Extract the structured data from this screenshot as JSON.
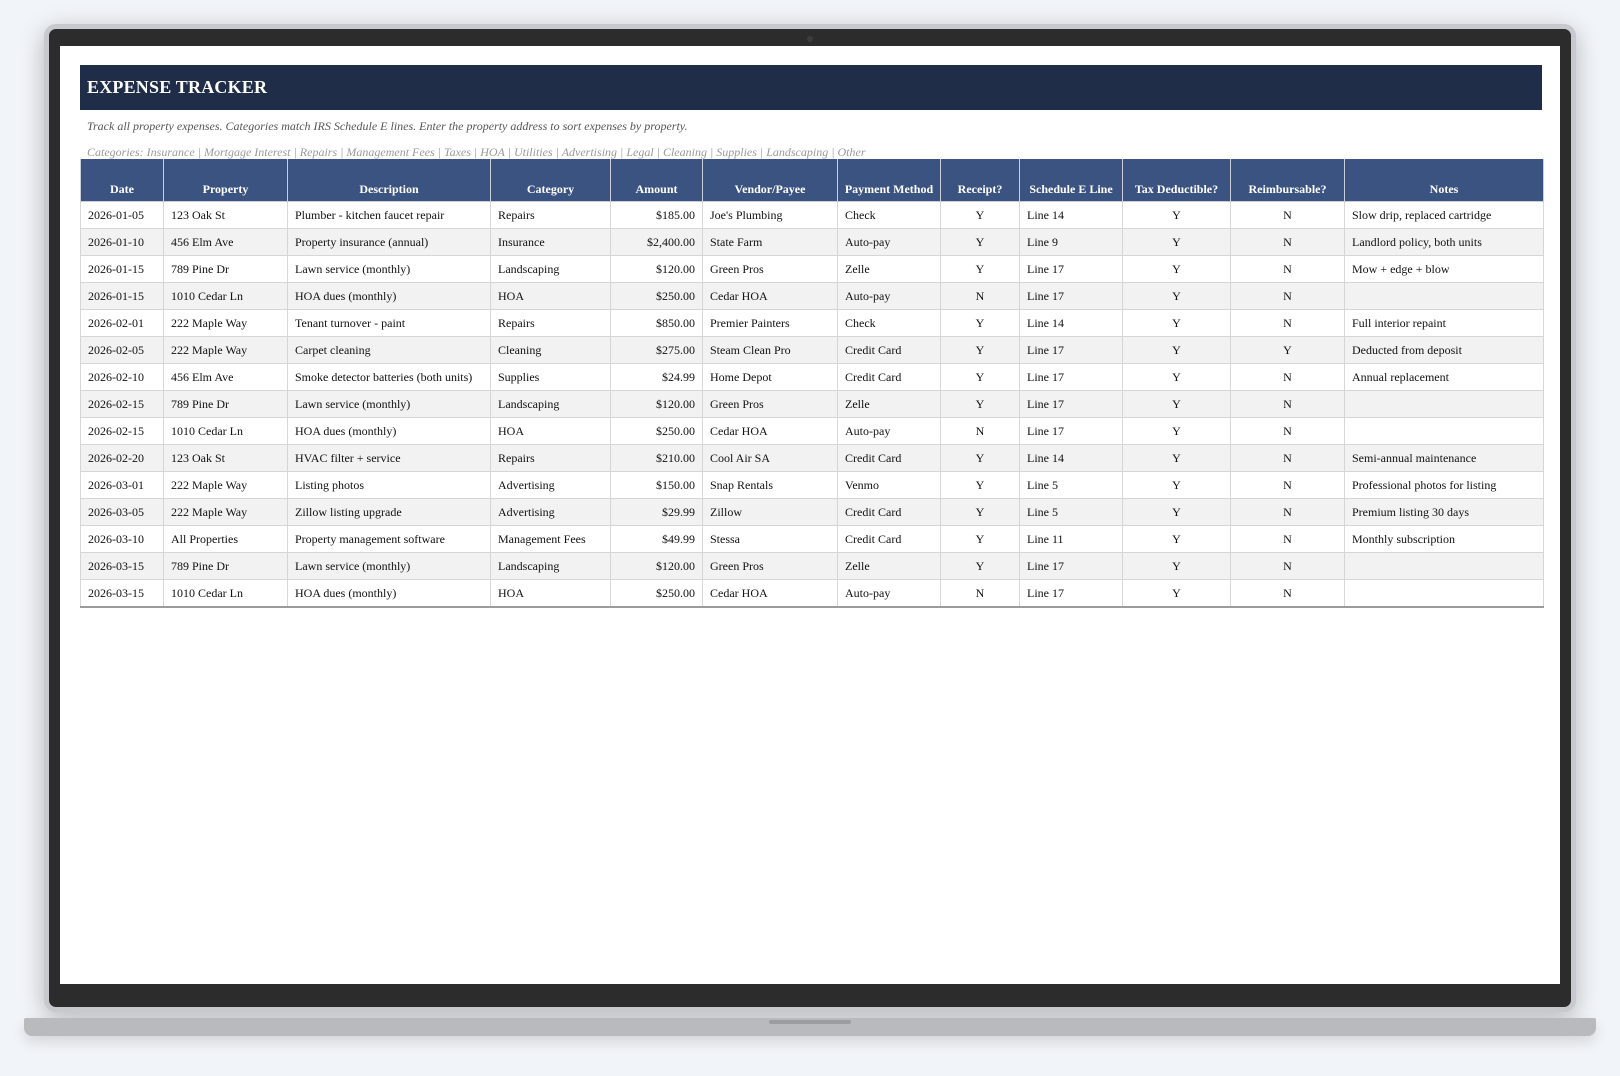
{
  "sheet": {
    "title": "EXPENSE TRACKER",
    "subtitle": "Track all property expenses. Categories match IRS Schedule E lines. Enter the property address to sort expenses by property.",
    "categories_note": "Categories: Insurance | Mortgage Interest | Repairs | Management Fees | Taxes | HOA | Utilities | Advertising | Legal | Cleaning | Supplies | Landscaping | Other"
  },
  "table": {
    "headers": [
      "Date",
      "Property",
      "Description",
      "Category",
      "Amount",
      "Vendor/Payee",
      "Payment Method",
      "Receipt?",
      "Schedule E Line",
      "Tax Deductible?",
      "Reimbursable?",
      "Notes"
    ],
    "rows": [
      [
        "2026-01-05",
        "123 Oak St",
        "Plumber - kitchen faucet repair",
        "Repairs",
        "$185.00",
        "Joe's Plumbing",
        "Check",
        "Y",
        "Line 14",
        "Y",
        "N",
        "Slow drip, replaced cartridge"
      ],
      [
        "2026-01-10",
        "456 Elm Ave",
        "Property insurance (annual)",
        "Insurance",
        "$2,400.00",
        "State Farm",
        "Auto-pay",
        "Y",
        "Line 9",
        "Y",
        "N",
        "Landlord policy, both units"
      ],
      [
        "2026-01-15",
        "789 Pine Dr",
        "Lawn service (monthly)",
        "Landscaping",
        "$120.00",
        "Green Pros",
        "Zelle",
        "Y",
        "Line 17",
        "Y",
        "N",
        "Mow + edge + blow"
      ],
      [
        "2026-01-15",
        "1010 Cedar Ln",
        "HOA dues (monthly)",
        "HOA",
        "$250.00",
        "Cedar HOA",
        "Auto-pay",
        "N",
        "Line 17",
        "Y",
        "N",
        ""
      ],
      [
        "2026-02-01",
        "222 Maple Way",
        "Tenant turnover - paint",
        "Repairs",
        "$850.00",
        "Premier Painters",
        "Check",
        "Y",
        "Line 14",
        "Y",
        "N",
        "Full interior repaint"
      ],
      [
        "2026-02-05",
        "222 Maple Way",
        "Carpet cleaning",
        "Cleaning",
        "$275.00",
        "Steam Clean Pro",
        "Credit Card",
        "Y",
        "Line 17",
        "Y",
        "Y",
        "Deducted from deposit"
      ],
      [
        "2026-02-10",
        "456 Elm Ave",
        "Smoke detector batteries (both units)",
        "Supplies",
        "$24.99",
        "Home Depot",
        "Credit Card",
        "Y",
        "Line 17",
        "Y",
        "N",
        "Annual replacement"
      ],
      [
        "2026-02-15",
        "789 Pine Dr",
        "Lawn service (monthly)",
        "Landscaping",
        "$120.00",
        "Green Pros",
        "Zelle",
        "Y",
        "Line 17",
        "Y",
        "N",
        ""
      ],
      [
        "2026-02-15",
        "1010 Cedar Ln",
        "HOA dues (monthly)",
        "HOA",
        "$250.00",
        "Cedar HOA",
        "Auto-pay",
        "N",
        "Line 17",
        "Y",
        "N",
        ""
      ],
      [
        "2026-02-20",
        "123 Oak St",
        "HVAC filter + service",
        "Repairs",
        "$210.00",
        "Cool Air SA",
        "Credit Card",
        "Y",
        "Line 14",
        "Y",
        "N",
        "Semi-annual maintenance"
      ],
      [
        "2026-03-01",
        "222 Maple Way",
        "Listing photos",
        "Advertising",
        "$150.00",
        "Snap Rentals",
        "Venmo",
        "Y",
        "Line 5",
        "Y",
        "N",
        "Professional photos for listing"
      ],
      [
        "2026-03-05",
        "222 Maple Way",
        "Zillow listing upgrade",
        "Advertising",
        "$29.99",
        "Zillow",
        "Credit Card",
        "Y",
        "Line 5",
        "Y",
        "N",
        "Premium listing 30 days"
      ],
      [
        "2026-03-10",
        "All Properties",
        "Property management software",
        "Management Fees",
        "$49.99",
        "Stessa",
        "Credit Card",
        "Y",
        "Line 11",
        "Y",
        "N",
        "Monthly subscription"
      ],
      [
        "2026-03-15",
        "789 Pine Dr",
        "Lawn service (monthly)",
        "Landscaping",
        "$120.00",
        "Green Pros",
        "Zelle",
        "Y",
        "Line 17",
        "Y",
        "N",
        ""
      ],
      [
        "2026-03-15",
        "1010 Cedar Ln",
        "HOA dues (monthly)",
        "HOA",
        "$250.00",
        "Cedar HOA",
        "Auto-pay",
        "N",
        "Line 17",
        "Y",
        "N",
        ""
      ]
    ]
  }
}
